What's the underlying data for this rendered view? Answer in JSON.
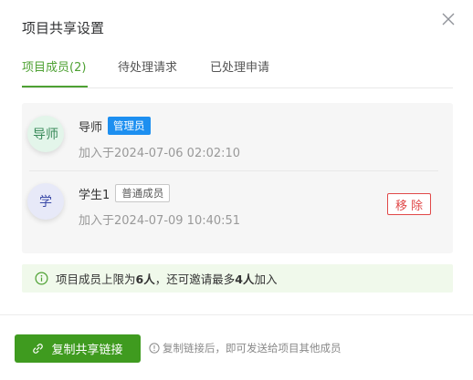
{
  "dialog": {
    "title": "项目共享设置"
  },
  "tabs": [
    {
      "label": "项目成员(2)",
      "active": true
    },
    {
      "label": "待处理请求",
      "active": false
    },
    {
      "label": "已处理申请",
      "active": false
    }
  ],
  "members": [
    {
      "avatar_text": "导师",
      "name": "导师",
      "role": "管理员",
      "joined": "加入于2024-07-06 02:02:10"
    },
    {
      "avatar_text": "学",
      "name": "学生1",
      "role": "普通成员",
      "joined": "加入于2024-07-09 10:40:51",
      "remove_label": "移除"
    }
  ],
  "notice": {
    "prefix": "项目成员上限为",
    "limit": "6人",
    "middle": "，还可邀请最多",
    "remaining": "4人",
    "suffix": "加入"
  },
  "footer": {
    "copy_button": "复制共享链接",
    "hint": "复制链接后，即可发送给项目其他成员"
  },
  "colors": {
    "accent": "#4ea133",
    "button_green": "#3f9b1f",
    "admin_badge": "#1d8ff0",
    "danger": "#e04848",
    "notice_bg": "#f0f9eb"
  },
  "icons": {
    "close": "close-icon",
    "info": "info-icon",
    "link": "link-icon"
  }
}
